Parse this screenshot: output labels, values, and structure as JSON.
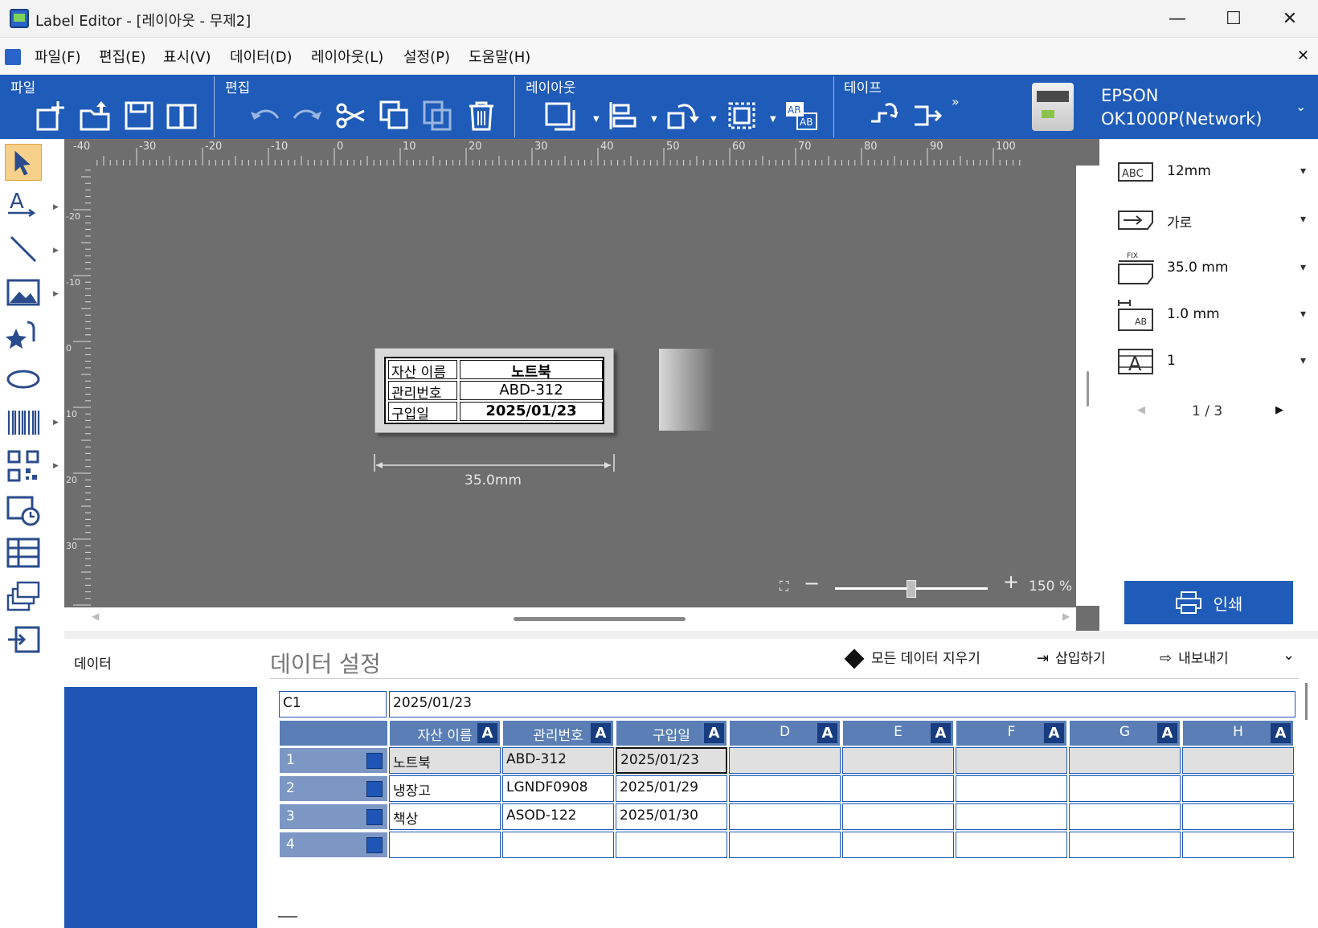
{
  "window": {
    "title": "Label Editor - [레이아웃 - 무제2]",
    "minimize": "—",
    "maximize": "☐",
    "close": "✕",
    "doc_close": "✕"
  },
  "menu": [
    "파일(F)",
    "편집(E)",
    "표시(V)",
    "데이터(D)",
    "레이아웃(L)",
    "설정(P)",
    "도움말(H)"
  ],
  "ribbon": {
    "groups": [
      "파일",
      "편집",
      "레이아웃",
      "테이프"
    ],
    "printer_brand": "EPSON",
    "printer_model": "OK1000P(Network)"
  },
  "canvas": {
    "ruler_top": [
      "-40",
      "-30",
      "-20",
      "-10",
      "0",
      "10",
      "20",
      "30",
      "40",
      "50",
      "60",
      "70",
      "80",
      "90",
      "100"
    ],
    "ruler_left": [
      "-20",
      "-10",
      "0",
      "10",
      "20",
      "30"
    ],
    "dimension": "35.0mm",
    "zoom": "150 %",
    "zoom_level": 0.5
  },
  "label": {
    "rows": [
      {
        "name": "자산 이름",
        "value": "노트북"
      },
      {
        "name": "관리번호",
        "value": "ABD-312"
      },
      {
        "name": "구입일",
        "value": "2025/01/23"
      }
    ]
  },
  "right_panel": {
    "tape_width": "12mm",
    "direction": "가로",
    "length": "35.0 mm",
    "margin": "1.0 mm",
    "copies": "1",
    "page": "1 / 3",
    "print": "인쇄"
  },
  "data": {
    "panel_label": "데이터",
    "settings_title": "데이터 설정",
    "clear_all": "모든 데이터 지우기",
    "insert": "삽입하기",
    "export": "내보내기",
    "cell_ref": "C1",
    "cell_value": "2025/01/23",
    "columns": [
      "자산 이름",
      "관리번호",
      "구입일",
      "D",
      "E",
      "F",
      "G",
      "H"
    ],
    "badge": "A",
    "rows": [
      {
        "num": "1",
        "cells": [
          "노트북",
          "ABD-312",
          "2025/01/23",
          "",
          "",
          "",
          "",
          ""
        ]
      },
      {
        "num": "2",
        "cells": [
          "냉장고",
          "LGNDF0908",
          "2025/01/29",
          "",
          "",
          "",
          "",
          ""
        ]
      },
      {
        "num": "3",
        "cells": [
          "책상",
          "ASOD-122",
          "2025/01/30",
          "",
          "",
          "",
          "",
          ""
        ]
      },
      {
        "num": "4",
        "cells": [
          "",
          "",
          "",
          "",
          "",
          "",
          "",
          ""
        ]
      }
    ]
  }
}
